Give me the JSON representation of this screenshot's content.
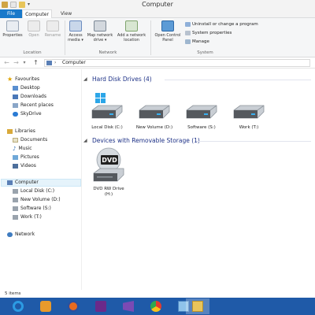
{
  "window": {
    "title": "Computer"
  },
  "tabs": [
    {
      "label": "File"
    },
    {
      "label": "Computer"
    },
    {
      "label": "View"
    }
  ],
  "ribbon": {
    "location": {
      "label": "Location",
      "buttons": [
        {
          "label": "Properties"
        },
        {
          "label": "Open"
        },
        {
          "label": "Rename"
        }
      ]
    },
    "network": {
      "label": "Network",
      "buttons": [
        {
          "line1": "Access",
          "line2": "media ▾"
        },
        {
          "line1": "Map network",
          "line2": "drive ▾"
        },
        {
          "line1": "Add a network",
          "line2": "location"
        }
      ]
    },
    "system": {
      "label": "System",
      "open_control_panel": {
        "line1": "Open Control",
        "line2": "Panel"
      },
      "items": [
        {
          "label": "Uninstall or change a program"
        },
        {
          "label": "System properties"
        },
        {
          "label": "Manage"
        }
      ]
    }
  },
  "address": {
    "path": "Computer"
  },
  "nav": {
    "favourites": {
      "label": "Favourites",
      "items": [
        {
          "label": "Desktop"
        },
        {
          "label": "Downloads"
        },
        {
          "label": "Recent places"
        },
        {
          "label": "SkyDrive"
        }
      ]
    },
    "libraries": {
      "label": "Libraries",
      "items": [
        {
          "label": "Documents"
        },
        {
          "label": "Music"
        },
        {
          "label": "Pictures"
        },
        {
          "label": "Videos"
        }
      ]
    },
    "computer": {
      "label": "Computer",
      "items": [
        {
          "label": "Local Disk (C:)"
        },
        {
          "label": "New Volume (D:)"
        },
        {
          "label": "Software (S:)"
        },
        {
          "label": "Work (T:)"
        }
      ]
    },
    "network": {
      "label": "Network"
    }
  },
  "groups": {
    "hdd": {
      "title": "Hard Disk Drives (4)",
      "drives": [
        {
          "label": "Local Disk (C:)"
        },
        {
          "label": "New Volume (D:)"
        },
        {
          "label": "Software (S:)"
        },
        {
          "label": "Work (T:)"
        }
      ]
    },
    "removable": {
      "title": "Devices with Removable Storage (1)",
      "drives": [
        {
          "line1": "DVD RW Drive",
          "line2": "(H:)",
          "disc_text": "DVD"
        }
      ]
    }
  },
  "status": {
    "text": "5 items"
  },
  "taskbar": {
    "apps": [
      {
        "icon": "internet-explorer-icon"
      },
      {
        "icon": "puzzle-app-icon"
      },
      {
        "icon": "firefox-icon"
      },
      {
        "icon": "game-app-icon"
      },
      {
        "icon": "visual-studio-icon"
      },
      {
        "icon": "chrome-icon"
      },
      {
        "icon": "paint-app-icon"
      },
      {
        "icon": "file-explorer-icon"
      }
    ]
  },
  "colors": {
    "accent": "#1979ca",
    "taskbar": "#1f5aa8",
    "group_heading": "#1e3287"
  }
}
